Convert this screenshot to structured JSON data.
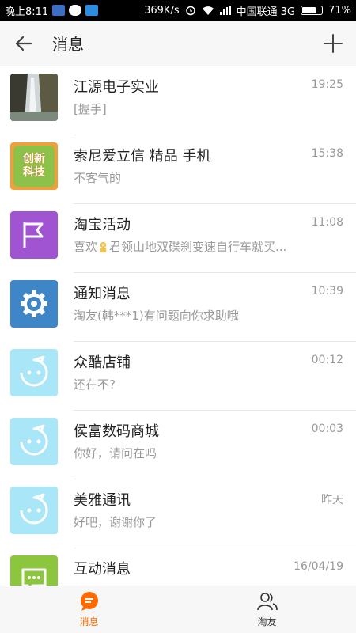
{
  "status_bar": {
    "time": "晚上8:11",
    "speed": "369K/s",
    "carrier": "中国联通 3G",
    "battery": "71%",
    "battery_level": 0.71
  },
  "header": {
    "title": "消息",
    "back_icon": "arrow-left-icon",
    "add_icon": "plus-icon"
  },
  "conversations": [
    {
      "name": "江源电子实业",
      "time": "19:25",
      "message": "[握手]",
      "avatar": "waterfall-photo"
    },
    {
      "name": "索尼爱立信 精品 手机",
      "time": "15:38",
      "message": "不客气的",
      "avatar": "logo-创新科技",
      "avatar_text": "创新科技"
    },
    {
      "name": "淘宝活动",
      "time": "11:08",
      "message_before": "喜欢",
      "message_after": "君领山地双碟刹变速自行车就买...",
      "avatar": "flag-icon",
      "color": "#a054d1"
    },
    {
      "name": "通知消息",
      "time": "10:39",
      "message": "淘友(韩***1)有问题向你求助哦",
      "avatar": "gear-icon",
      "color": "#3f86c9"
    },
    {
      "name": "众酷店铺",
      "time": "00:12",
      "message": "还在不?",
      "avatar": "default-shop-face",
      "color": "#a9e6f7"
    },
    {
      "name": "侯富数码商城",
      "time": "00:03",
      "message": "你好，请问在吗",
      "avatar": "default-shop-face",
      "color": "#a9e6f7"
    },
    {
      "name": "美雅通讯",
      "time": "昨天",
      "message": "好吧，谢谢你了",
      "avatar": "default-shop-face",
      "color": "#a9e6f7"
    },
    {
      "name": "互动消息",
      "time": "16/04/19",
      "message": "",
      "avatar": "chat-bubble-icon",
      "color": "#8cc63f"
    }
  ],
  "tabs": [
    {
      "label": "消息",
      "icon": "message-bubble-icon",
      "active": true,
      "color": "#ff6a00"
    },
    {
      "label": "淘友",
      "icon": "friends-icon",
      "active": false,
      "color": "#333333"
    }
  ]
}
